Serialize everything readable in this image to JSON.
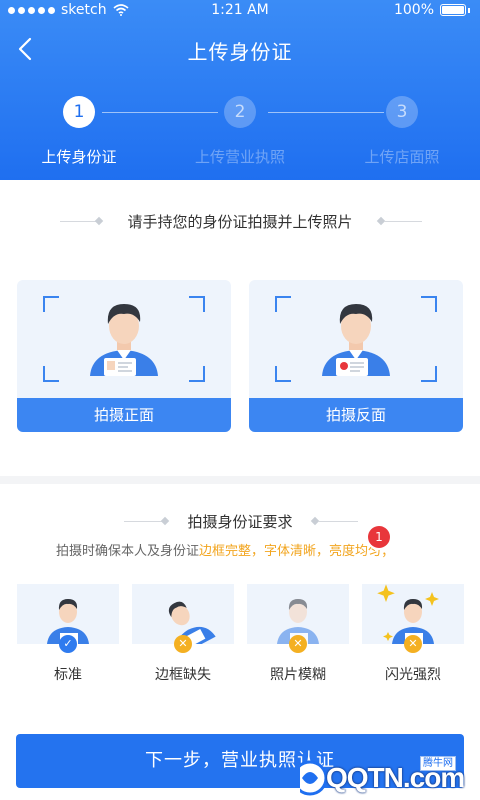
{
  "status_bar": {
    "carrier": "sketch",
    "time": "1:21 AM",
    "battery": "100%"
  },
  "header": {
    "title": "上传身份证"
  },
  "steps": [
    {
      "number": "1",
      "label": "上传身份证",
      "active": true
    },
    {
      "number": "2",
      "label": "上传营业执照",
      "active": false
    },
    {
      "number": "3",
      "label": "上传店面照",
      "active": false
    }
  ],
  "capture": {
    "heading": "请手持您的身份证拍摄并上传照片",
    "front_button": "拍摄正面",
    "back_button": "拍摄反面"
  },
  "requirements": {
    "heading": "拍摄身份证要求",
    "text_plain": "拍摄时确保本人及身份证",
    "text_highlight": "边框完整，字体清晰，亮度均匀；",
    "badge_count": "1",
    "examples": [
      {
        "label": "标准",
        "status": "ok",
        "icon": "check-icon"
      },
      {
        "label": "边框缺失",
        "status": "bad",
        "icon": "cross-icon"
      },
      {
        "label": "照片模糊",
        "status": "bad",
        "icon": "cross-icon"
      },
      {
        "label": "闪光强烈",
        "status": "bad",
        "icon": "cross-icon"
      }
    ]
  },
  "footer": {
    "next_button": "下一步，营业执照认证"
  },
  "watermark": {
    "site": "QQTN.com",
    "tag": "腾牛网"
  },
  "colors": {
    "primary": "#2473EF",
    "highlight": "#F2A51F",
    "ok": "#2F7BEF",
    "bad": "#F4B022",
    "badge": "#E8363B"
  }
}
